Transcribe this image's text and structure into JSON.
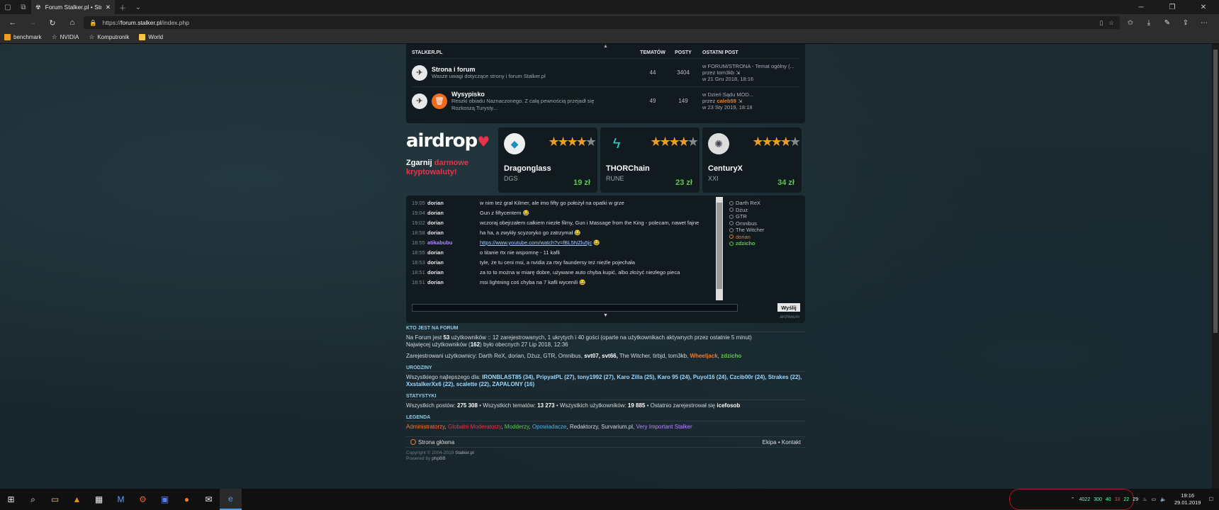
{
  "browser": {
    "tab_title": "Forum Stalker.pl • Stron",
    "url_prefix": "https://",
    "url_host": "forum.stalker.pl",
    "url_path": "/index.php",
    "bookmarks": [
      "benchmark",
      "NVIDIA",
      "Komputronik",
      "World"
    ]
  },
  "forum": {
    "header": {
      "col1": "STALKER.PL",
      "col2": "TEMATÓW",
      "col3": "POSTY",
      "col4": "OSTATNI POST"
    },
    "rows": [
      {
        "title": "Strona i forum",
        "desc": "Wasze uwagi dotyczące strony i forum Stalker.pl",
        "topics": "44",
        "posts": "3404",
        "last_line1": "w FORUM/STRONA - Temat ogólny (...",
        "last_by_prefix": "przez",
        "last_by": "tom3kb",
        "last_date": "w 21 Gru 2018, 18:16"
      },
      {
        "title": "Wysypisko",
        "desc": "Reszki obiadu Naznaczonego. Z całą pewnością przejadł się Rozkoszą Turysty...",
        "topics": "49",
        "posts": "149",
        "last_line1": "w Dzień Sądu MOD...",
        "last_by_prefix": "przez",
        "last_by": "caleb59",
        "last_date": "w 23 Sty 2019, 18:18"
      }
    ]
  },
  "ad": {
    "logo": "airdrop",
    "tag_white1": "Zgarnij",
    "tag_red1": "darmowe",
    "tag_red2": "kryptowaluty!",
    "coins": [
      {
        "name": "Dragonglass",
        "symbol": "DGS",
        "price": "19 zł",
        "rating": 4
      },
      {
        "name": "THORChain",
        "symbol": "RUNE",
        "price": "23 zł",
        "rating": 4
      },
      {
        "name": "CenturyX",
        "symbol": "XXI",
        "price": "34 zł",
        "rating": 4
      }
    ]
  },
  "shoutbox": {
    "messages": [
      {
        "time": "19:05",
        "nick": "dorian",
        "text": "w nim też grał Kilmer, ale imo fifty go położył na opatki w grze"
      },
      {
        "time": "19:04",
        "nick": "dorian",
        "text": "Gun z fiftycentem 😂"
      },
      {
        "time": "19:02",
        "nick": "dorian",
        "text": "wczoraj obejrzałem całkiem niezłe filmy, Gun i Massage from the King - polecam, nawet fajne"
      },
      {
        "time": "18:58",
        "nick": "dorian",
        "text": "ha ha, a zwykły scyzoryko go zatrzymał 😂"
      },
      {
        "time": "18:55",
        "nick": "atikabubu",
        "text": "https://www.youtube.com/watch?v=fBL5NZlu5jc",
        "link": true,
        "purple": true
      },
      {
        "time": "18:55",
        "nick": "dorian",
        "text": "o titanie rtx nie wspomnę - 11 kafli"
      },
      {
        "time": "18:53",
        "nick": "dorian",
        "text": "tyle, że tu ceni msi, a nvidia za rtxy faundersy też nieźle pojechała"
      },
      {
        "time": "18:51",
        "nick": "dorian",
        "text": "za to to można w miarę dobre, używane auto chyba kupić, albo złożyć niezłego pieca"
      },
      {
        "time": "18:51",
        "nick": "dorian",
        "text": "msi lightning coś chyba na 7 kafli wycenili 😂"
      }
    ],
    "online": [
      {
        "name": "Darth ReX",
        "kind": "normal"
      },
      {
        "name": "Dżuz",
        "kind": "normal"
      },
      {
        "name": "GTR",
        "kind": "normal"
      },
      {
        "name": "Omnibus",
        "kind": "normal"
      },
      {
        "name": "The Witcher",
        "kind": "normal"
      },
      {
        "name": "dorian",
        "kind": "orange"
      },
      {
        "name": "zdzicho",
        "kind": "green"
      }
    ],
    "send_label": "Wyślij",
    "archive_label": "archiwum"
  },
  "who": {
    "heading": "KTO JEST NA FORUM",
    "line1_a": "Na Forum jest ",
    "line1_total": "53",
    "line1_b": " użytkowników :: 12 zarejestrowanych, 1 ukrytych i 40 gości (oparte na użytkownikach aktywnych przez ostatnie 5 minut)",
    "line2_a": "Najwięcej użytkowników (",
    "line2_max": "162",
    "line2_b": ") było obecnych 27 Lip 2018, 12:36",
    "registered_label": "Zarejestrowani użytkownicy:",
    "registered_plain": "Darth ReX, dorian, Dżuz, GTR, Omnibus,",
    "registered_bold": "svt07, svt66,",
    "registered_plain2": "The Witcher, tirbjd, tom3kb,",
    "registered_orange": "Wheeljack",
    "registered_green": "zdzicho"
  },
  "birthdays": {
    "heading": "URODZINY",
    "prefix": "Wszystkiego najlepszego dla:",
    "list": "IRONBLAST85 (34), PripyatPL (27), tony1992 (27), Karo Zilla (25), Karo 95 (24), Puyol16 (24), Czcib00r (24), Strakes (22), XxstalkerXx6 (22), scalette (22), ZAPALONY (16)"
  },
  "stats": {
    "heading": "STATYSTYKI",
    "posts_label": "Wszystkich postów:",
    "posts": "275 308",
    "topics_label": "Wszystkich tematów:",
    "topics": "13 273",
    "users_label": "Wszystkich użytkowników:",
    "users": "19 885",
    "newest_label": "Ostatnio zarejestrował się",
    "newest": "icefosob"
  },
  "legend": {
    "heading": "LEGENDA",
    "admin": "Administratorzy",
    "glob": "Globalni Moderatorzy",
    "mod": "Modderzy",
    "op": "Opowiadacze",
    "rest": "Redaktorzy, Survarium.pl,",
    "vip": "Very Important Stalker"
  },
  "footer": {
    "home": "Strona główna",
    "right": "Ekipa • Kontakt",
    "copyright": "Copyright © 2004-2019",
    "site": "Stalker.pl",
    "powered": "Powered by",
    "engine": "phpBB"
  },
  "taskbar": {
    "tray_nums": [
      "4022",
      "300",
      "40",
      "33",
      "22",
      "29"
    ],
    "time": "19:16",
    "date": "29.01.2019"
  }
}
